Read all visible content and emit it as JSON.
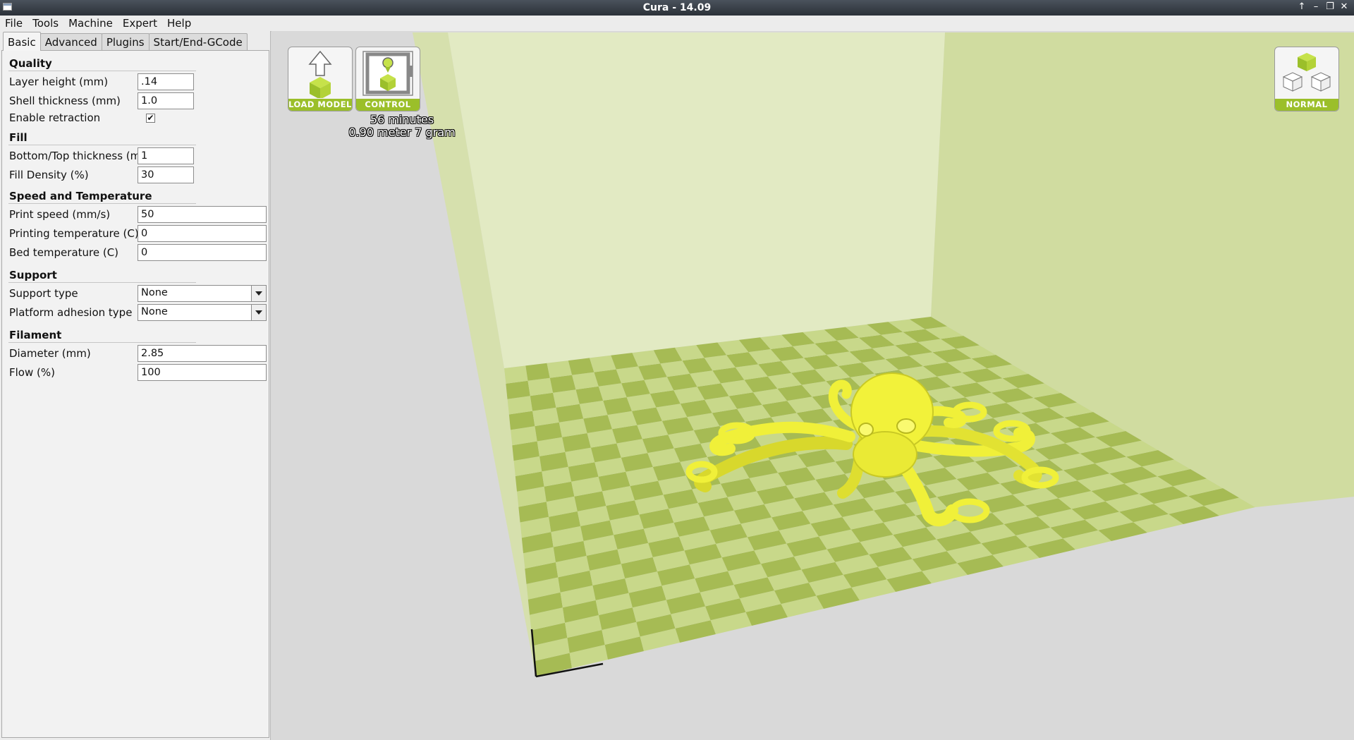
{
  "window": {
    "title": "Cura - 14.09"
  },
  "menu": [
    "File",
    "Tools",
    "Machine",
    "Expert",
    "Help"
  ],
  "tabs": [
    "Basic",
    "Advanced",
    "Plugins",
    "Start/End-GCode"
  ],
  "active_tab": "Basic",
  "settings": {
    "quality": {
      "title": "Quality",
      "layer_height_label": "Layer height (mm)",
      "layer_height": ".14",
      "shell_label": "Shell thickness (mm)",
      "shell": "1.0",
      "retraction_label": "Enable retraction",
      "retraction": true
    },
    "fill": {
      "title": "Fill",
      "bottom_top_label": "Bottom/Top thickness (mm)",
      "bottom_top": "1",
      "density_label": "Fill Density (%)",
      "density": "30"
    },
    "speed": {
      "title": "Speed and Temperature",
      "print_speed_label": "Print speed (mm/s)",
      "print_speed": "50",
      "print_temp_label": "Printing temperature (C)",
      "print_temp": "0",
      "bed_temp_label": "Bed temperature (C)",
      "bed_temp": "0"
    },
    "support": {
      "title": "Support",
      "support_type_label": "Support type",
      "support_type": "None",
      "adhesion_label": "Platform adhesion type",
      "adhesion": "None"
    },
    "filament": {
      "title": "Filament",
      "diameter_label": "Diameter (mm)",
      "diameter": "2.85",
      "flow_label": "Flow (%)",
      "flow": "100"
    }
  },
  "viewport": {
    "load_model_label": "LOAD MODEL",
    "control_label": "CONTROL",
    "normal_label": "NORMAL",
    "print_time": "56 minutes",
    "print_material": "0.90 meter 7 gram"
  },
  "colors": {
    "accent": "#9bbf2a",
    "model": "#f2f23a",
    "plate_light": "#c8d88a",
    "plate_dark": "#a6bb54",
    "volume_wall": "#e3ebc5"
  }
}
